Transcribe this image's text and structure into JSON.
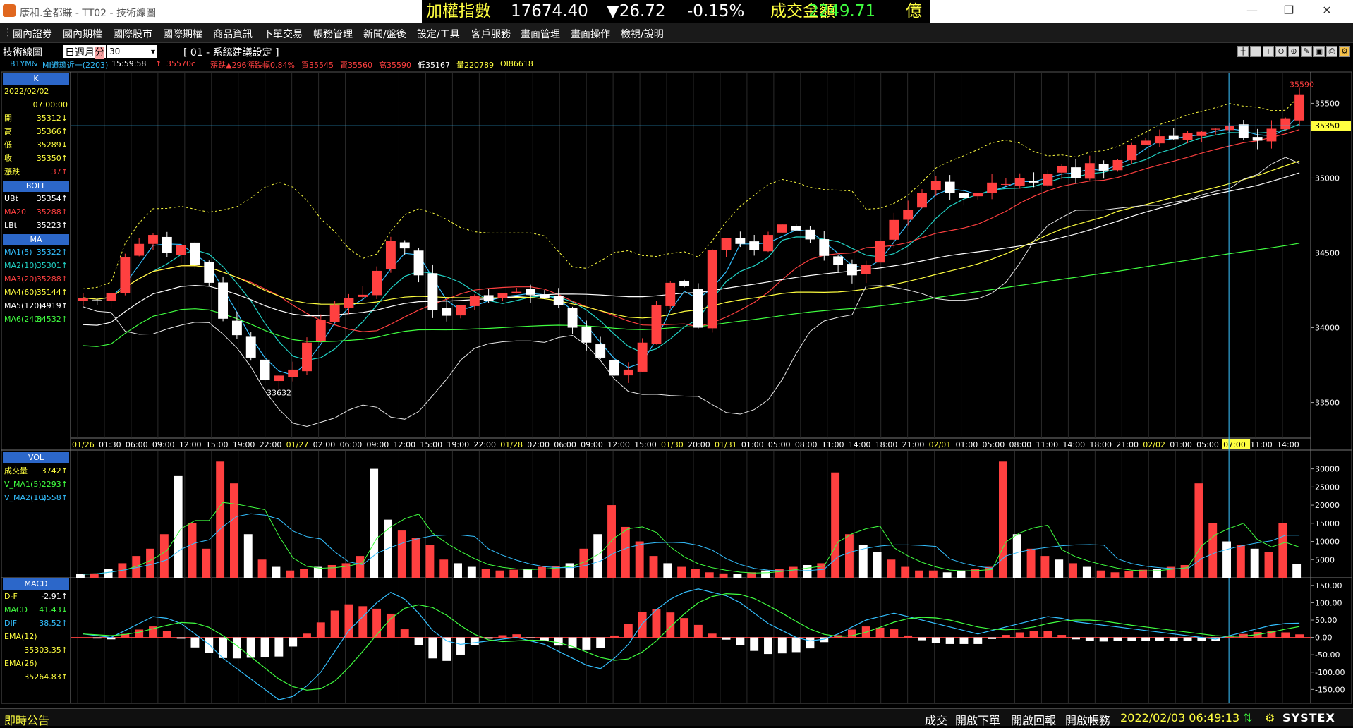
{
  "window": {
    "title": "康和.全都賺 - TT02 - 技術線圖",
    "ticker": {
      "index_name": "加權指數",
      "index_value": "17674.40",
      "change": "▼26.72",
      "change_pct": "-0.15%",
      "volume_label": "成交金額",
      "volume_value": "2249.71",
      "unit": "億"
    }
  },
  "menu": [
    "國內證券",
    "國內期權",
    "國際股市",
    "國際期權",
    "商品資訊",
    "下單交易",
    "帳務管理",
    "新聞/盤後",
    "設定/工具",
    "客戶服務",
    "畫面管理",
    "畫面操作",
    "檢視/說明"
  ],
  "toolbar": {
    "panel_label": "技術線圖",
    "period_tabs": [
      "日",
      "週",
      "月",
      "分"
    ],
    "interval": "30",
    "settings_label": "[ 01 - 系統建議設定 ]"
  },
  "info_line": {
    "symbol": "B1YM&",
    "name": "MI道瓊近一(2203)",
    "time": "15:59:58",
    "arrow": "↑",
    "price": "35570c",
    "change": "漲跌▲296",
    "change_pct": "漲跌幅0.84%",
    "bid": "買35545",
    "ask": "賣35560",
    "high": "高35590",
    "low": "低35167",
    "volume": "量220789",
    "oi": "OI86618"
  },
  "side": {
    "k_header": "K",
    "date": "2022/02/02",
    "time": "07:00:00",
    "k_rows": [
      {
        "label": "開",
        "value": "35312↓"
      },
      {
        "label": "高",
        "value": "35366↑"
      },
      {
        "label": "低",
        "value": "35289↓"
      },
      {
        "label": "收",
        "value": "35350↑"
      },
      {
        "label": "漲跌",
        "value": "37↑"
      }
    ],
    "boll_header": "BOLL",
    "boll_rows": [
      {
        "label": "UBt",
        "value": "35354↑",
        "color": "#ffffff"
      },
      {
        "label": "MA20",
        "value": "35288↑",
        "color": "#ff4040"
      },
      {
        "label": "LBt",
        "value": "35223↑",
        "color": "#ffffff"
      }
    ],
    "ma_header": "MA",
    "ma_rows": [
      {
        "label": "MA1(5)",
        "value": "35322↑",
        "color": "#34c0ff"
      },
      {
        "label": "MA2(10)",
        "value": "35301↑",
        "color": "#22d3c6"
      },
      {
        "label": "MA3(20)",
        "value": "35288↑",
        "color": "#ff4040"
      },
      {
        "label": "MA4(60)",
        "value": "35144↑",
        "color": "#ffff40"
      },
      {
        "label": "MA5(120)",
        "value": "34919↑",
        "color": "#ffffff"
      },
      {
        "label": "MA6(240)",
        "value": "34532↑",
        "color": "#40ff40"
      }
    ],
    "vol_header": "VOL",
    "vol_rows": [
      {
        "label": "成交量",
        "value": "3742↑",
        "color": "#ffff40"
      },
      {
        "label": "V_MA1(5)",
        "value": "2293↑",
        "color": "#40ff40"
      },
      {
        "label": "V_MA2(10)",
        "value": "2558↑",
        "color": "#34c0ff"
      }
    ],
    "macd_header": "MACD",
    "macd_rows": [
      {
        "label": "D-F",
        "value": "-2.91↑",
        "color": "#ffff40"
      },
      {
        "label": "MACD",
        "value": "41.43↓",
        "color": "#40ff40"
      },
      {
        "label": "DIF",
        "value": "38.52↑",
        "color": "#34c0ff"
      },
      {
        "label": "EMA(12)",
        "value": "",
        "color": "#ffff40"
      },
      {
        "label": "",
        "value": "35303.35↑",
        "color": "#ffff40"
      },
      {
        "label": "EMA(26)",
        "value": "",
        "color": "#ffff40"
      },
      {
        "label": "",
        "value": "35264.83↑",
        "color": "#ffff40"
      }
    ]
  },
  "axes": {
    "price_ticks": [
      "35500",
      "35000",
      "34500",
      "34000",
      "33500"
    ],
    "price_label_high": "35590",
    "price_label_cursor": "35350",
    "price_label_low": "33632",
    "time_ticks": [
      {
        "text": "01/26",
        "date": true
      },
      {
        "text": "01:30"
      },
      {
        "text": "06:00"
      },
      {
        "text": "09:00"
      },
      {
        "text": "12:00"
      },
      {
        "text": "15:00"
      },
      {
        "text": "19:00"
      },
      {
        "text": "22:00"
      },
      {
        "text": "01/27",
        "date": true
      },
      {
        "text": "02:00"
      },
      {
        "text": "06:00"
      },
      {
        "text": "09:00"
      },
      {
        "text": "12:00"
      },
      {
        "text": "15:00"
      },
      {
        "text": "19:00"
      },
      {
        "text": "22:00"
      },
      {
        "text": "01/28",
        "date": true
      },
      {
        "text": "02:00"
      },
      {
        "text": "06:00"
      },
      {
        "text": "09:00"
      },
      {
        "text": "12:00"
      },
      {
        "text": "15:00"
      },
      {
        "text": "01/30",
        "date": true
      },
      {
        "text": "20:00"
      },
      {
        "text": "01/31",
        "date": true
      },
      {
        "text": "01:00"
      },
      {
        "text": "05:00"
      },
      {
        "text": "08:00"
      },
      {
        "text": "11:00"
      },
      {
        "text": "14:00"
      },
      {
        "text": "18:00"
      },
      {
        "text": "21:00"
      },
      {
        "text": "02/01",
        "date": true
      },
      {
        "text": "01:00"
      },
      {
        "text": "05:00"
      },
      {
        "text": "08:00"
      },
      {
        "text": "11:00"
      },
      {
        "text": "14:00"
      },
      {
        "text": "18:00"
      },
      {
        "text": "21:00"
      },
      {
        "text": "02/02",
        "date": true
      },
      {
        "text": "01:00"
      },
      {
        "text": "05:00"
      },
      {
        "text": "07:00",
        "cursor": true
      },
      {
        "text": "11:00"
      },
      {
        "text": "14:00"
      }
    ],
    "vol_ticks": [
      "30000",
      "25000",
      "20000",
      "15000",
      "10000",
      "5000"
    ],
    "macd_ticks": [
      "150.00",
      "100.00",
      "50.00",
      "0.00",
      "-50.00",
      "-100.00",
      "-150.00"
    ]
  },
  "chart_data": {
    "type": "candlestick",
    "price_range": [
      33300,
      35700
    ],
    "volume_range": [
      0,
      34000
    ],
    "macd_range": [
      -190,
      170
    ],
    "price_path": [
      34200,
      34180,
      34230,
      34470,
      34560,
      34620,
      34500,
      34550,
      34420,
      34300,
      34060,
      33950,
      33800,
      33650,
      33680,
      33720,
      33900,
      34050,
      34150,
      34200,
      34220,
      34380,
      34580,
      34530,
      34350,
      34120,
      34080,
      34150,
      34210,
      34180,
      34230,
      34240,
      34220,
      34200,
      34150,
      34000,
      33900,
      33800,
      33680,
      33720,
      33900,
      34150,
      34300,
      34280,
      34000,
      34520,
      34600,
      34560,
      34520,
      34620,
      34690,
      34650,
      34590,
      34480,
      34420,
      34350,
      34420,
      34580,
      34720,
      34790,
      34900,
      34980,
      34900,
      34870,
      34900,
      34970,
      34960,
      35000,
      34970,
      35030,
      35080,
      35000,
      35100,
      35050,
      35120,
      35220,
      35250,
      35280,
      35260,
      35300,
      35310,
      35330,
      35350,
      35270,
      35250,
      35330,
      35400,
      35560
    ],
    "volume_path": [
      1000,
      1200,
      2500,
      4000,
      6000,
      8000,
      12000,
      28000,
      15000,
      8000,
      32000,
      26000,
      12000,
      5000,
      3000,
      2000,
      2500,
      3000,
      3500,
      4000,
      6000,
      30000,
      16000,
      13000,
      11000,
      9000,
      5000,
      4000,
      3000,
      2500,
      2000,
      2200,
      2500,
      3000,
      3200,
      4000,
      8000,
      12000,
      20000,
      14000,
      10000,
      6000,
      4000,
      3000,
      2500,
      1500,
      1200,
      1000,
      1500,
      2000,
      2500,
      3000,
      3500,
      4000,
      29000,
      12000,
      9000,
      7000,
      5000,
      3000,
      2000,
      2000,
      1500,
      2000,
      2500,
      3000,
      32000,
      12000,
      8000,
      6000,
      5000,
      4000,
      3000,
      2000,
      1500,
      1800,
      2200,
      2500,
      3000,
      3500,
      26000,
      15000,
      10000,
      9000,
      8000,
      7000,
      15000,
      3742
    ],
    "macd_path": [
      10,
      5,
      0,
      20,
      40,
      60,
      55,
      40,
      10,
      -20,
      -60,
      -90,
      -120,
      -150,
      -180,
      -170,
      -140,
      -100,
      -40,
      20,
      60,
      100,
      130,
      110,
      70,
      20,
      -10,
      -20,
      -15,
      -10,
      -5,
      0,
      -10,
      -20,
      -40,
      -60,
      -80,
      -90,
      -60,
      -20,
      40,
      80,
      110,
      130,
      140,
      130,
      120,
      100,
      70,
      40,
      20,
      0,
      -10,
      -5,
      10,
      30,
      50,
      60,
      70,
      60,
      50,
      40,
      30,
      20,
      10,
      20,
      30,
      40,
      50,
      60,
      55,
      45,
      40,
      35,
      30,
      25,
      20,
      15,
      10,
      5,
      0,
      -5,
      5,
      15,
      25,
      35,
      40,
      41
    ]
  },
  "status": {
    "left": "即時公告",
    "items": [
      "成交",
      "開啟下單",
      "開啟回報",
      "開啟帳務"
    ],
    "datetime": "2022/02/03 06:49:13",
    "brand": "SYSTEX"
  }
}
